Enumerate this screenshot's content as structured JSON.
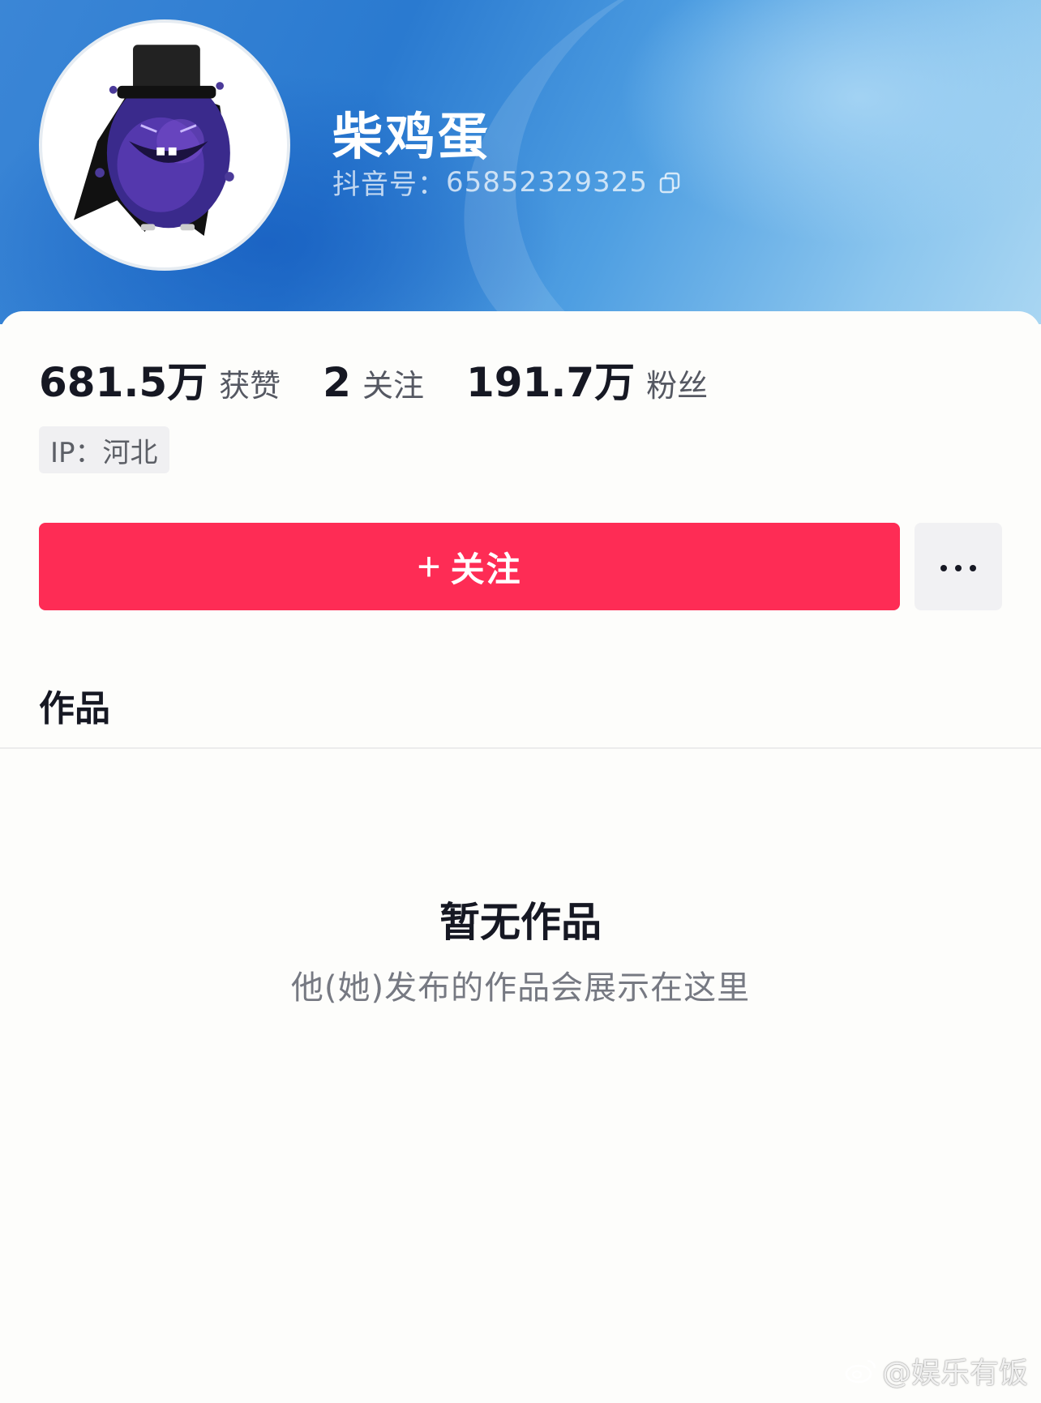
{
  "profile": {
    "nickname": "柴鸡蛋",
    "account_label": "抖音号：",
    "account_id": "65852329325",
    "avatar_icon": "purple-egg-character-avatar",
    "copy_icon": "copy-icon"
  },
  "stats": [
    {
      "value": "681.5万",
      "label": "获赞"
    },
    {
      "value": "2",
      "label": "关注"
    },
    {
      "value": "191.7万",
      "label": "粉丝"
    }
  ],
  "ip_tag": "IP：河北",
  "actions": {
    "follow_plus": "+",
    "follow_label": "关注",
    "more_icon": "more-dots-icon"
  },
  "tabs": {
    "works_label": "作品"
  },
  "empty_state": {
    "title": "暂无作品",
    "subtitle": "他(她)发布的作品会展示在这里"
  },
  "watermark": {
    "text": "@娱乐有饭",
    "icon": "weibo-icon"
  },
  "colors": {
    "follow_button": "#fe2c55",
    "header_blue": "#2a7ad0",
    "text_primary": "#161823",
    "text_secondary": "#767982"
  }
}
